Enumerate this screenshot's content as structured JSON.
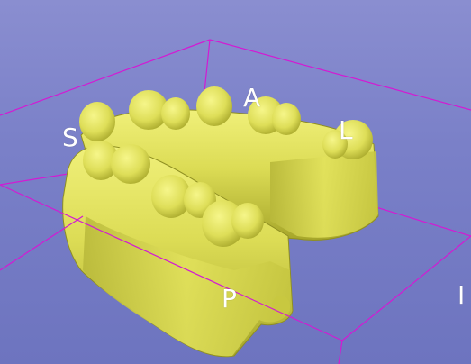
{
  "viewer": {
    "background_top": "#8a8ed0",
    "background_bottom": "#6d74bf",
    "model_color": "#e3e35e",
    "box_color": "#d31ad3"
  },
  "orientation_labels": {
    "superior": "S",
    "anterior": "A",
    "left": "L",
    "posterior": "P",
    "inferior": "I"
  }
}
